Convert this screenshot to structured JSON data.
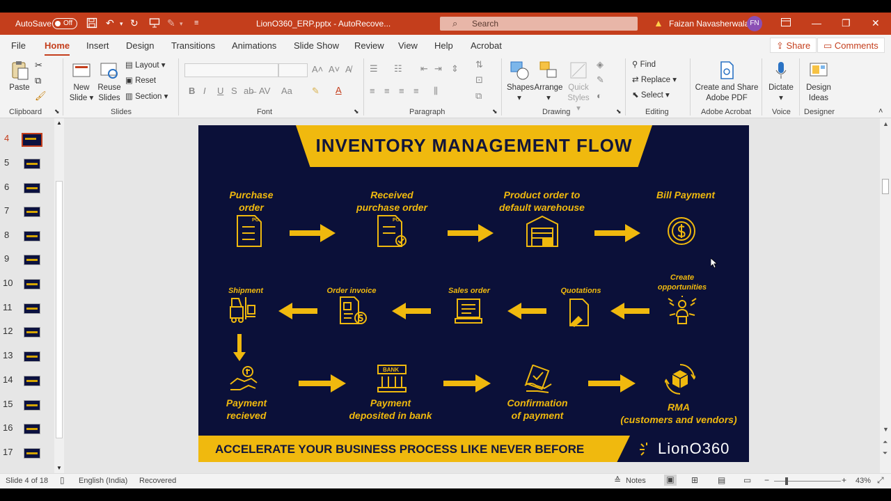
{
  "titlebar": {
    "autosave_label": "AutoSave",
    "autosave_state": "Off",
    "filename": "LionO360_ERP.pptx - AutoRecove...",
    "search_placeholder": "Search",
    "user_name": "Faizan Navasherwala",
    "user_initials": "FN"
  },
  "tabs": {
    "items": [
      "File",
      "Home",
      "Insert",
      "Design",
      "Transitions",
      "Animations",
      "Slide Show",
      "Review",
      "View",
      "Help",
      "Acrobat"
    ],
    "active": "Home",
    "share": "Share",
    "comments": "Comments"
  },
  "ribbon": {
    "clipboard": {
      "paste": "Paste",
      "label": "Clipboard"
    },
    "slides": {
      "new_slide": "New",
      "new_slide2": "Slide",
      "reuse": "Reuse",
      "reuse2": "Slides",
      "layout": "Layout",
      "reset": "Reset",
      "section": "Section",
      "label": "Slides"
    },
    "font": {
      "label": "Font",
      "bold": "B",
      "italic": "I",
      "underline": "U",
      "strike": "S"
    },
    "paragraph": {
      "label": "Paragraph"
    },
    "drawing": {
      "shapes": "Shapes",
      "arrange": "Arrange",
      "quick_styles": "Quick",
      "quick_styles2": "Styles",
      "label": "Drawing"
    },
    "editing": {
      "find": "Find",
      "replace": "Replace",
      "select": "Select",
      "label": "Editing"
    },
    "acrobat": {
      "create": "Create and Share",
      "create2": "Adobe PDF",
      "label": "Adobe Acrobat"
    },
    "voice": {
      "dictate": "Dictate",
      "label": "Voice"
    },
    "designer": {
      "design": "Design",
      "design2": "Ideas",
      "label": "Designer"
    }
  },
  "thumbnails": {
    "numbers": [
      "4",
      "5",
      "6",
      "7",
      "8",
      "9",
      "10",
      "11",
      "12",
      "13",
      "14",
      "15",
      "16",
      "17"
    ],
    "active": "4"
  },
  "slide": {
    "title": "INVENTORY MANAGEMENT FLOW",
    "row1": [
      {
        "label1": "Purchase",
        "label2": "order",
        "icon": "po-document-icon"
      },
      {
        "label1": "Received",
        "label2": "purchase order",
        "icon": "po-checked-icon"
      },
      {
        "label1": "Product order to",
        "label2": "default warehouse",
        "icon": "warehouse-icon"
      },
      {
        "label1": "Bill Payment",
        "label2": "",
        "icon": "coin-icon"
      }
    ],
    "row2": [
      {
        "label1": "Shipment",
        "label2": "",
        "icon": "forklift-icon"
      },
      {
        "label1": "Order invoice",
        "label2": "",
        "icon": "invoice-icon"
      },
      {
        "label1": "Sales order",
        "label2": "",
        "icon": "sales-terminal-icon"
      },
      {
        "label1": "Quotations",
        "label2": "",
        "icon": "quotation-pen-icon"
      },
      {
        "label1": "Create",
        "label2": "opportunities",
        "icon": "opportunity-icon"
      }
    ],
    "row3": [
      {
        "label1": "Payment",
        "label2": "recieved",
        "icon": "handshake-money-icon"
      },
      {
        "label1": "Payment",
        "label2": "deposited in bank",
        "icon": "bank-icon"
      },
      {
        "label1": "Confirmation",
        "label2": "of payment",
        "icon": "confirm-payment-icon"
      },
      {
        "label1": "RMA",
        "label2": "(customers and vendors)",
        "icon": "return-box-icon"
      }
    ],
    "footer": "ACCELERATE YOUR BUSINESS PROCESS LIKE NEVER BEFORE",
    "logo": "LionO360"
  },
  "status": {
    "slide_of": "Slide 4 of 18",
    "language": "English (India)",
    "recovered": "Recovered",
    "notes": "Notes",
    "zoom": "43%"
  },
  "colors": {
    "accent": "#c43e1c",
    "slide_bg": "#0b1039",
    "gold": "#f0b90e"
  }
}
